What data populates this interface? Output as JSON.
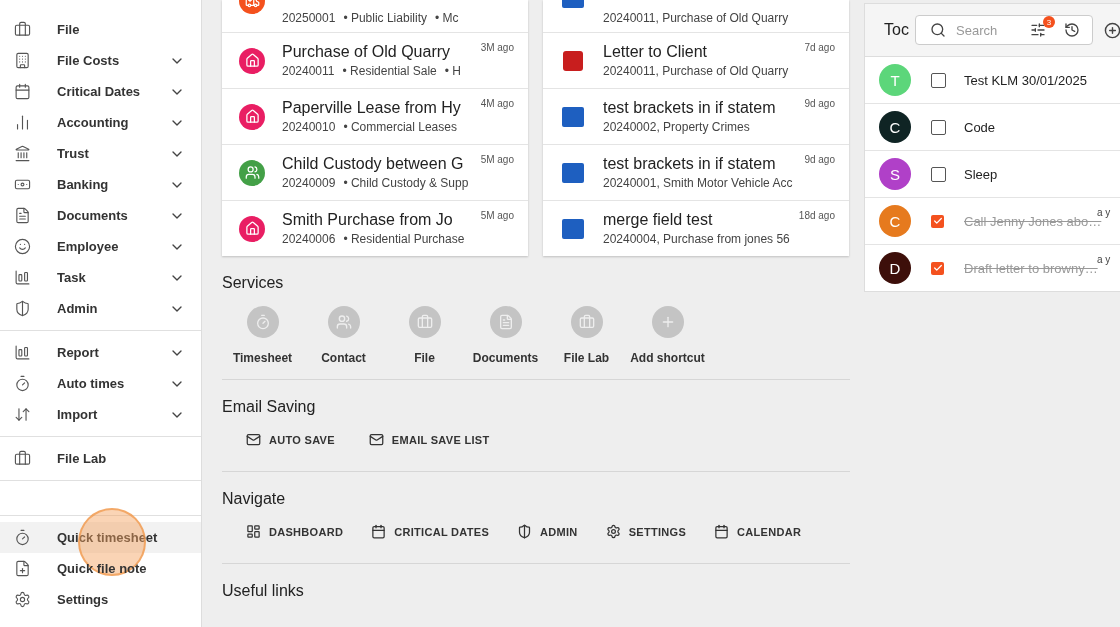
{
  "sidebar": {
    "groups": [
      {
        "items": [
          {
            "label": "File",
            "expandable": false,
            "selected": false
          },
          {
            "label": "File Costs",
            "expandable": true,
            "selected": false
          },
          {
            "label": "Critical Dates",
            "expandable": true,
            "selected": false
          },
          {
            "label": "Accounting",
            "expandable": true,
            "selected": false
          },
          {
            "label": "Trust",
            "expandable": true,
            "selected": false
          },
          {
            "label": "Banking",
            "expandable": true,
            "selected": false
          },
          {
            "label": "Documents",
            "expandable": true,
            "selected": false
          },
          {
            "label": "Employee",
            "expandable": true,
            "selected": false
          },
          {
            "label": "Task",
            "expandable": true,
            "selected": false
          },
          {
            "label": "Admin",
            "expandable": true,
            "selected": false
          }
        ]
      },
      {
        "items": [
          {
            "label": "Report",
            "expandable": true,
            "selected": false
          },
          {
            "label": "Auto times",
            "expandable": true,
            "selected": false
          },
          {
            "label": "Import",
            "expandable": true,
            "selected": false
          }
        ]
      },
      {
        "items": [
          {
            "label": "File Lab",
            "expandable": false,
            "selected": false
          }
        ]
      },
      {
        "items": [
          {
            "label": "Quick timesheet",
            "expandable": false,
            "selected": true
          },
          {
            "label": "Quick file note",
            "expandable": false,
            "selected": false
          },
          {
            "label": "Settings",
            "expandable": false,
            "selected": false
          }
        ]
      }
    ]
  },
  "matters": [
    {
      "kind": "medical",
      "color": "#f4511e",
      "number": "20250001",
      "tags": [
        "• Public Liability",
        "• Mc"
      ]
    },
    {
      "kind": "property",
      "color": "#e91e63",
      "title": "Purchase of Old Quarry",
      "number": "20240011",
      "tags": [
        "• Residential Sale",
        "• H"
      ],
      "age": "3M ago"
    },
    {
      "kind": "property",
      "color": "#e91e63",
      "title": "Paperville Lease from Hy",
      "number": "20240010",
      "tags": [
        "• Commercial Leases"
      ],
      "age": "4M ago"
    },
    {
      "kind": "family",
      "color": "#43a047",
      "title": "Child Custody between G",
      "number": "20240009",
      "tags": [
        "• Child Custody & Supp"
      ],
      "age": "5M ago"
    },
    {
      "kind": "property",
      "color": "#e91e63",
      "title": "Smith Purchase from Jo",
      "number": "20240006",
      "tags": [
        "• Residential Purchase"
      ],
      "age": "5M ago"
    }
  ],
  "documents": [
    {
      "kind": "word",
      "subtitle": "20240011, Purchase of Old Quarry"
    },
    {
      "kind": "pdf",
      "title": "Letter to Client",
      "subtitle": "20240011, Purchase of Old Quarry",
      "age": "7d ago"
    },
    {
      "kind": "word",
      "title": "test brackets in if statem",
      "subtitle": "20240002, Property Crimes",
      "age": "9d ago"
    },
    {
      "kind": "word",
      "title": "test brackets in if statem",
      "subtitle": "20240001, Smith Motor Vehicle Acc",
      "age": "9d ago"
    },
    {
      "kind": "word",
      "title": "merge field test",
      "subtitle": "20240004, Purchase from jones 56",
      "age": "18d ago"
    }
  ],
  "services": {
    "title": "Services",
    "shortcuts": [
      "Timesheet",
      "Contact",
      "File",
      "Documents",
      "File Lab",
      "Add shortcut"
    ]
  },
  "email_saving": {
    "title": "Email Saving",
    "buttons": [
      "AUTO SAVE",
      "EMAIL SAVE LIST"
    ]
  },
  "navigate": {
    "title": "Navigate",
    "buttons": [
      "DASHBOARD",
      "CRITICAL DATES",
      "ADMIN",
      "SETTINGS",
      "CALENDAR"
    ]
  },
  "useful_links": {
    "title": "Useful links"
  },
  "todos": {
    "title": "Toc",
    "search": {
      "placeholder": "Search"
    },
    "filter_count": "3",
    "items": [
      {
        "initial": "T",
        "color": "#5cd67a",
        "checked": false,
        "title": "Test KLM 30/01/2025"
      },
      {
        "initial": "C",
        "color": "#0f2424",
        "checked": false,
        "title": "Code"
      },
      {
        "initial": "S",
        "color": "#b040c8",
        "checked": false,
        "title": "Sleep"
      },
      {
        "initial": "C",
        "color": "#e67a1e",
        "checked": true,
        "title": "Call Jenny Jones abo…",
        "age": "a y"
      },
      {
        "initial": "D",
        "color": "#3d0f0a",
        "checked": true,
        "title": "Draft letter to browny…",
        "age": "a y"
      }
    ]
  }
}
